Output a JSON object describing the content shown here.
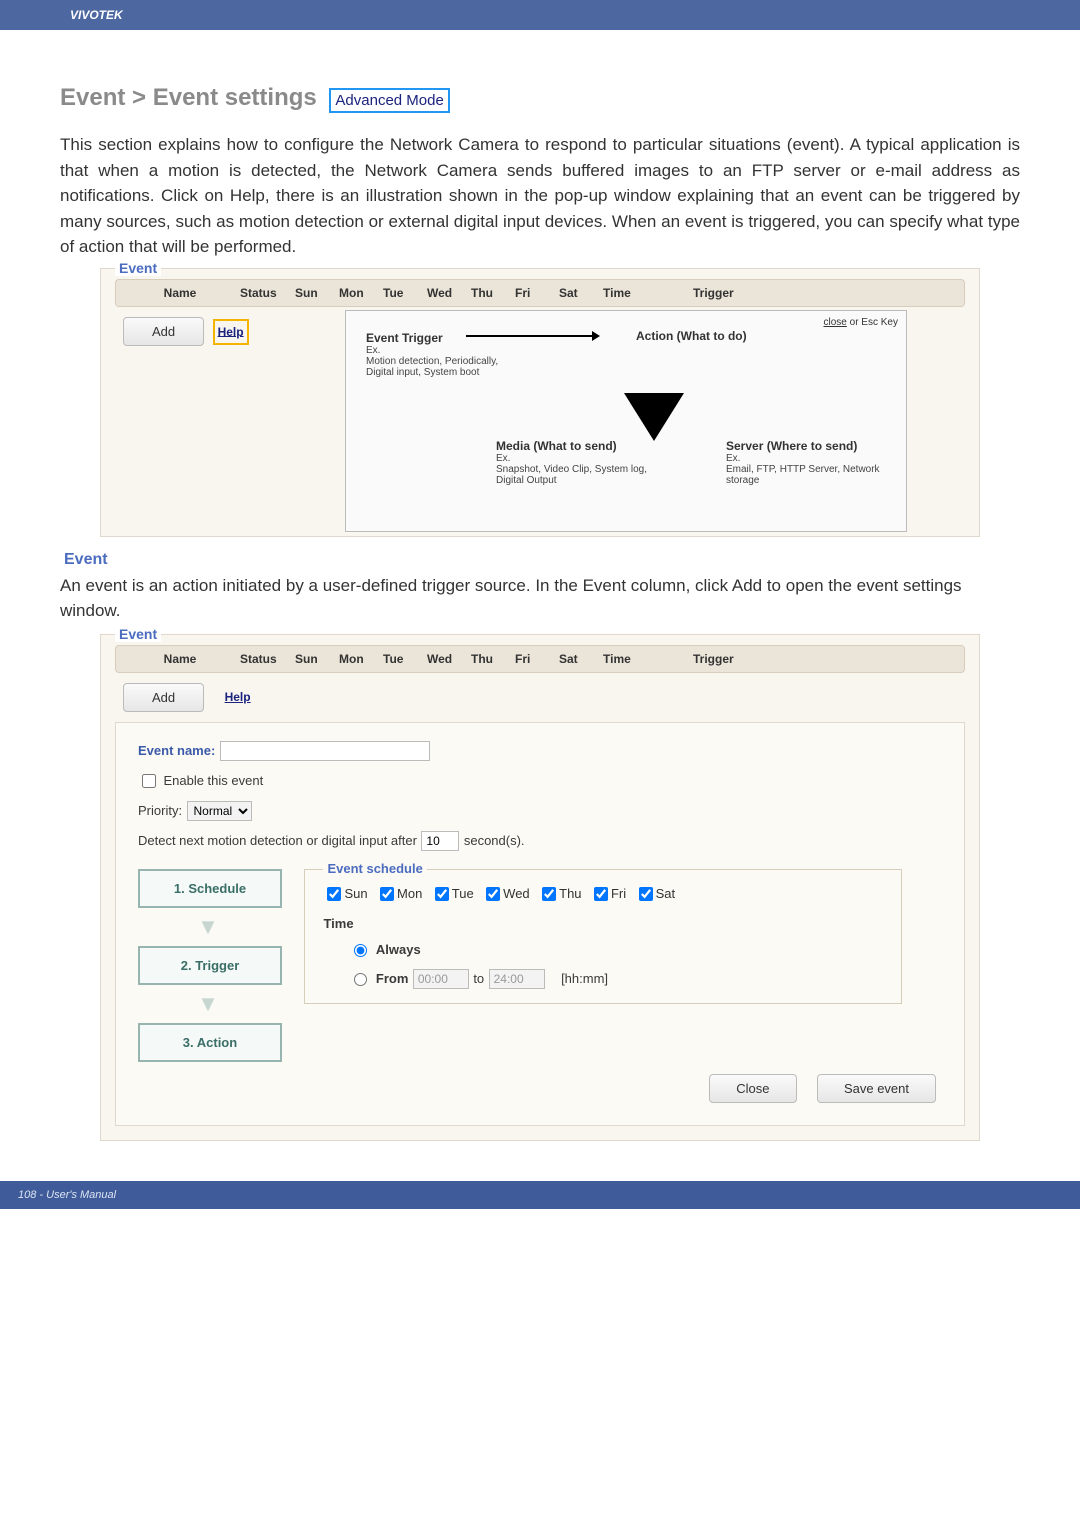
{
  "brand": "VIVOTEK",
  "title_prefix": "Event > Event settings",
  "mode_badge": "Advanced Mode",
  "intro": "This section explains how to configure the Network Camera to respond to particular situations (event). A typical application is that when a motion is detected, the Network Camera sends buffered images to an FTP server or e-mail address as notifications. Click on Help, there is an illustration shown in the pop-up window explaining that an event can be triggered by many sources, such as motion detection or external digital input devices. When an event is triggered, you can specify what type of action that will be performed.",
  "event_fieldset_legend": "Event",
  "table_headers": [
    "Name",
    "Status",
    "Sun",
    "Mon",
    "Tue",
    "Wed",
    "Thu",
    "Fri",
    "Sat",
    "Time",
    "Trigger"
  ],
  "add_button": "Add",
  "help_link": "Help",
  "help_box": {
    "close": "close",
    "close_suffix": " or Esc Key",
    "event_trigger_title": "Event Trigger",
    "event_trigger_ex": "Ex.",
    "event_trigger_text": "Motion detection, Periodically, Digital input, System boot",
    "action_title": "Action (What to do)",
    "media_title": "Media (What to send)",
    "media_ex": "Ex.",
    "media_text": "Snapshot, Video Clip, System log, Digital Output",
    "server_title": "Server (Where to send)",
    "server_ex": "Ex.",
    "server_text": "Email, FTP, HTTP Server, Network storage"
  },
  "event_section_label": "Event",
  "event_desc": "An event is an action initiated by a user-defined trigger source. In the Event column, click Add to open the event settings window.",
  "config": {
    "event_name_label": "Event name:",
    "event_name_value": "",
    "enable_label": "Enable this event",
    "priority_label": "Priority:",
    "priority_value": "Normal",
    "detect_label_pre": "Detect next motion detection or digital input after",
    "detect_value": "10",
    "detect_label_post": "second(s).",
    "schedule_legend": "Event schedule",
    "days": [
      "Sun",
      "Mon",
      "Tue",
      "Wed",
      "Thu",
      "Fri",
      "Sat"
    ],
    "time_label": "Time",
    "always_label": "Always",
    "from_label": "From",
    "from_value": "00:00",
    "to_label": "to",
    "to_value": "24:00",
    "hhmm": "[hh:mm]",
    "steps": [
      "1. Schedule",
      "2. Trigger",
      "3. Action"
    ],
    "close_btn": "Close",
    "save_btn": "Save event"
  },
  "footer": "108 - User's Manual"
}
